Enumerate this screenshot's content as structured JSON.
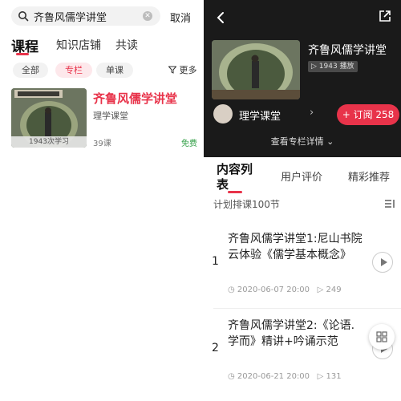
{
  "left": {
    "search": {
      "value": "齐鲁风儒学讲堂",
      "cancel": "取消"
    },
    "tabs": [
      "课程",
      "知识店铺",
      "共读"
    ],
    "chips": [
      "全部",
      "专栏",
      "单课"
    ],
    "more": "更多",
    "result": {
      "title": "齐鲁风儒学讲堂",
      "channel": "理学课堂",
      "learners": "1943次学习",
      "lessons": "39课",
      "price": "免费"
    }
  },
  "right": {
    "hero": {
      "title": "齐鲁风儒学讲堂",
      "plays": "1943 播放",
      "channel": "理学课堂",
      "subscribe": "+ 订阅 258",
      "details": "查看专栏详情"
    },
    "tabs": [
      "内容列表",
      "用户评价",
      "精彩推荐"
    ],
    "plan": "计划排课100节",
    "lessons": [
      {
        "num": "1",
        "title": "齐鲁风儒学讲堂1:尼山书院云体验《儒学基本概念》",
        "date": "2020-06-07 20:00",
        "plays": "249"
      },
      {
        "num": "2",
        "title": "齐鲁风儒学讲堂2:《论语.学而》精讲+吟诵示范",
        "date": "2020-06-21 20:00",
        "plays": "131"
      }
    ]
  },
  "colors": {
    "accent": "#e8334a",
    "free": "#2f9e44",
    "hero_bg": "#1a1a1a"
  }
}
